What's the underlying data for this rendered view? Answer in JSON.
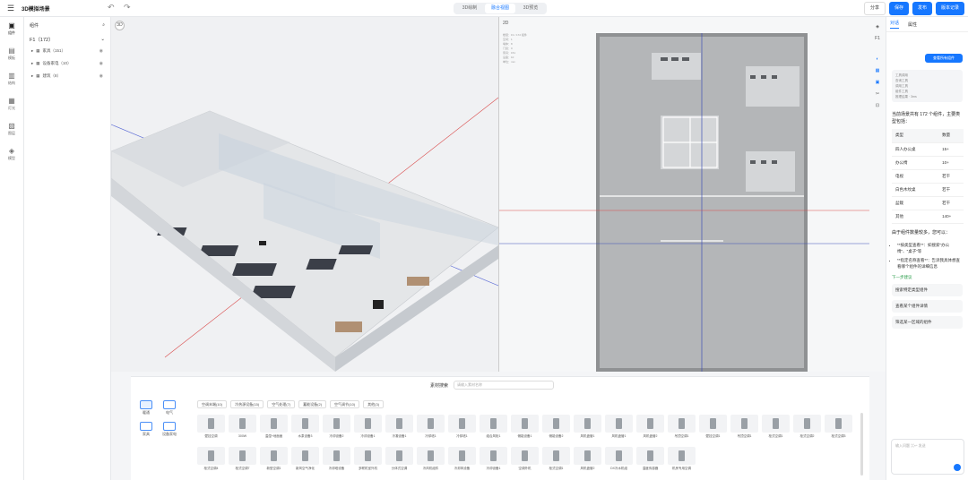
{
  "app": {
    "title": "3D模拟场景"
  },
  "view_tabs": [
    {
      "label": "3D绘制",
      "active": false
    },
    {
      "label": "融合视图",
      "active": true
    },
    {
      "label": "3D预览",
      "active": false
    }
  ],
  "top_buttons": {
    "share": "分享",
    "save": "保存",
    "publish": "发布",
    "version": "版本记录"
  },
  "icon_sidebar": [
    {
      "label": "组件",
      "icon": "cube-icon"
    },
    {
      "label": "模板",
      "icon": "template-icon"
    },
    {
      "label": "结构",
      "icon": "structure-icon"
    },
    {
      "label": "灯光",
      "icon": "light-icon"
    },
    {
      "label": "图层",
      "icon": "image-icon"
    },
    {
      "label": "模型",
      "icon": "layers-icon"
    }
  ],
  "tree": {
    "title": "组件",
    "floor": "F1（172）",
    "nodes": [
      {
        "label": "家具（151）"
      },
      {
        "label": "设备家电（10）"
      },
      {
        "label": "建筑（8）"
      }
    ]
  },
  "viewport_3d": {
    "label": "3D"
  },
  "plan_view": {
    "label": "2D",
    "floor_label": "F1",
    "info_lines": [
      "楼层：F1 / 172 组件",
      "空间：1",
      "墙体：8",
      "门窗：0",
      "家具：151",
      "设备：10",
      "单位：mm"
    ]
  },
  "right_panel": {
    "tabs": [
      "对话",
      "属性"
    ],
    "action_button": "查看所有组件",
    "steps": [
      "工具调用",
      "查询工具",
      "调用工具",
      "组件工具",
      "推理结果 · 3ms"
    ],
    "message": "当前场景共有 172 个组件，主要类型包括：",
    "table_header": [
      "类型",
      "数量"
    ],
    "table_rows": [
      [
        "四人办公桌",
        "15+"
      ],
      [
        "办公椅",
        "10+"
      ],
      [
        "电视",
        "若干"
      ],
      [
        "白色木纹桌",
        "若干"
      ],
      [
        "盆栽",
        "若干"
      ],
      [
        "其他",
        "140+"
      ]
    ],
    "followup": "由于组件数量较多，您可以：",
    "bullets": [
      "**按类型查看**：如搜索\"办公椅\"、\"桌子\"等",
      "**指定名称查看**：告诉我具体想查看哪个组件的详细信息"
    ],
    "next_label": "下一步建议",
    "suggestions": [
      "搜索特定类型组件",
      "查看某个组件详情",
      "筛选某一区域的组件"
    ],
    "input_placeholder": "输入问题 ⌘↩ 发送"
  },
  "library": {
    "search_label": "素材搜索",
    "search_placeholder": "请输入素材名称",
    "categories": [
      {
        "label": "暖通",
        "active": true
      },
      {
        "label": "电气",
        "active": false
      },
      {
        "label": "家具",
        "active": false
      },
      {
        "label": "设备家电",
        "active": false
      }
    ],
    "filters": [
      "空调末端(10)",
      "冷热源设备(15)",
      "空气处理(7)",
      "蓄能设备(2)",
      "空气调节(10)",
      "其他(3)"
    ],
    "items": [
      "壁挂空调",
      "300W",
      "温湿+地面面",
      "水泵设备3",
      "冷却设备2",
      "冷却设备1",
      "冷凝设备1",
      "冷却塔1",
      "冷却塔1",
      "组合风柜1",
      "储能设备1",
      "储能设备2",
      "风机盘管1",
      "风机盘管1",
      "风机盘管2",
      "吊顶空调1",
      "壁挂空调1",
      "吊顶空调1",
      "柜式空调1",
      "柜式空调2",
      "柜式空调3",
      "柜式空调4",
      "柜式空调7",
      "新型空调1",
      "新风空气净化",
      "冷却塔设备",
      "多联机室外机",
      "分体式空调",
      "冷风机组件",
      "冷却风设备",
      "冷却设备1",
      "空调外机",
      "柜式空调1",
      "风机盘管2",
      "DX冷水机组",
      "温度传感器",
      "机房专用空调"
    ]
  }
}
